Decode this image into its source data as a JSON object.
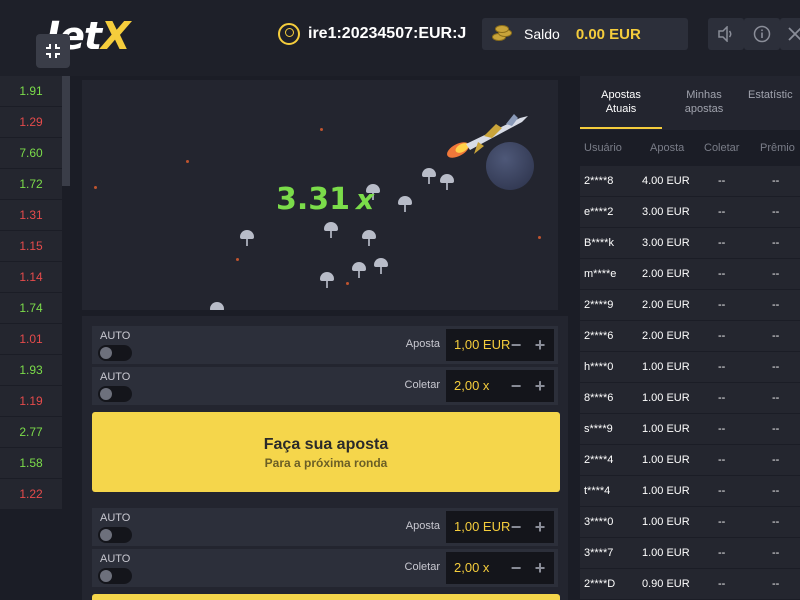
{
  "header": {
    "logo_part1": "Jet",
    "logo_part2": "X",
    "username": "ire1:20234507:EUR:J",
    "balance_label": "Saldo",
    "balance_value": "0.00 EUR"
  },
  "history": [
    {
      "value": "1.91",
      "color": "green"
    },
    {
      "value": "1.29",
      "color": "red"
    },
    {
      "value": "7.60",
      "color": "green"
    },
    {
      "value": "1.72",
      "color": "green"
    },
    {
      "value": "1.31",
      "color": "red"
    },
    {
      "value": "1.15",
      "color": "red"
    },
    {
      "value": "1.14",
      "color": "red"
    },
    {
      "value": "1.74",
      "color": "green"
    },
    {
      "value": "1.01",
      "color": "red"
    },
    {
      "value": "1.93",
      "color": "green"
    },
    {
      "value": "1.19",
      "color": "red"
    },
    {
      "value": "2.77",
      "color": "green"
    },
    {
      "value": "1.58",
      "color": "green"
    },
    {
      "value": "1.22",
      "color": "red"
    }
  ],
  "game": {
    "multiplier": "3.31",
    "multiplier_suffix": "x"
  },
  "bet_panel_1": {
    "auto1_label": "AUTO",
    "bet_label": "Aposta",
    "bet_value": "1,00 EUR",
    "auto2_label": "AUTO",
    "cashout_label": "Coletar",
    "cashout_value": "2,00 x",
    "button_title": "Faça sua aposta",
    "button_subtitle": "Para a próxima ronda"
  },
  "bet_panel_2": {
    "auto1_label": "AUTO",
    "bet_label": "Aposta",
    "bet_value": "1,00 EUR",
    "auto2_label": "AUTO",
    "cashout_label": "Coletar",
    "cashout_value": "2,00 x"
  },
  "right_panel": {
    "tabs": [
      {
        "label_line1": "Apostas",
        "label_line2": "Atuais"
      },
      {
        "label_line1": "Minhas",
        "label_line2": "apostas"
      },
      {
        "label_line1": "Estatístic",
        "label_line2": ""
      }
    ],
    "columns": [
      "Usuário",
      "Aposta",
      "Coletar",
      "Prêmio"
    ],
    "bets": [
      {
        "user": "2****8",
        "bet": "4.00 EUR",
        "cashout": "--",
        "prize": "--"
      },
      {
        "user": "e****2",
        "bet": "3.00 EUR",
        "cashout": "--",
        "prize": "--"
      },
      {
        "user": "B****k",
        "bet": "3.00 EUR",
        "cashout": "--",
        "prize": "--"
      },
      {
        "user": "m****e",
        "bet": "2.00 EUR",
        "cashout": "--",
        "prize": "--"
      },
      {
        "user": "2****9",
        "bet": "2.00 EUR",
        "cashout": "--",
        "prize": "--"
      },
      {
        "user": "2****6",
        "bet": "2.00 EUR",
        "cashout": "--",
        "prize": "--"
      },
      {
        "user": "h****0",
        "bet": "1.00 EUR",
        "cashout": "--",
        "prize": "--"
      },
      {
        "user": "8****6",
        "bet": "1.00 EUR",
        "cashout": "--",
        "prize": "--"
      },
      {
        "user": "s****9",
        "bet": "1.00 EUR",
        "cashout": "--",
        "prize": "--"
      },
      {
        "user": "2****4",
        "bet": "1.00 EUR",
        "cashout": "--",
        "prize": "--"
      },
      {
        "user": "t****4",
        "bet": "1.00 EUR",
        "cashout": "--",
        "prize": "--"
      },
      {
        "user": "3****0",
        "bet": "1.00 EUR",
        "cashout": "--",
        "prize": "--"
      },
      {
        "user": "3****7",
        "bet": "1.00 EUR",
        "cashout": "--",
        "prize": "--"
      },
      {
        "user": "2****D",
        "bet": "0.90 EUR",
        "cashout": "--",
        "prize": "--"
      }
    ]
  },
  "colors": {
    "accent": "#f5cd3c",
    "win": "#7bdc4a",
    "loss": "#e54b4b",
    "bet_button": "#f5d64b"
  }
}
